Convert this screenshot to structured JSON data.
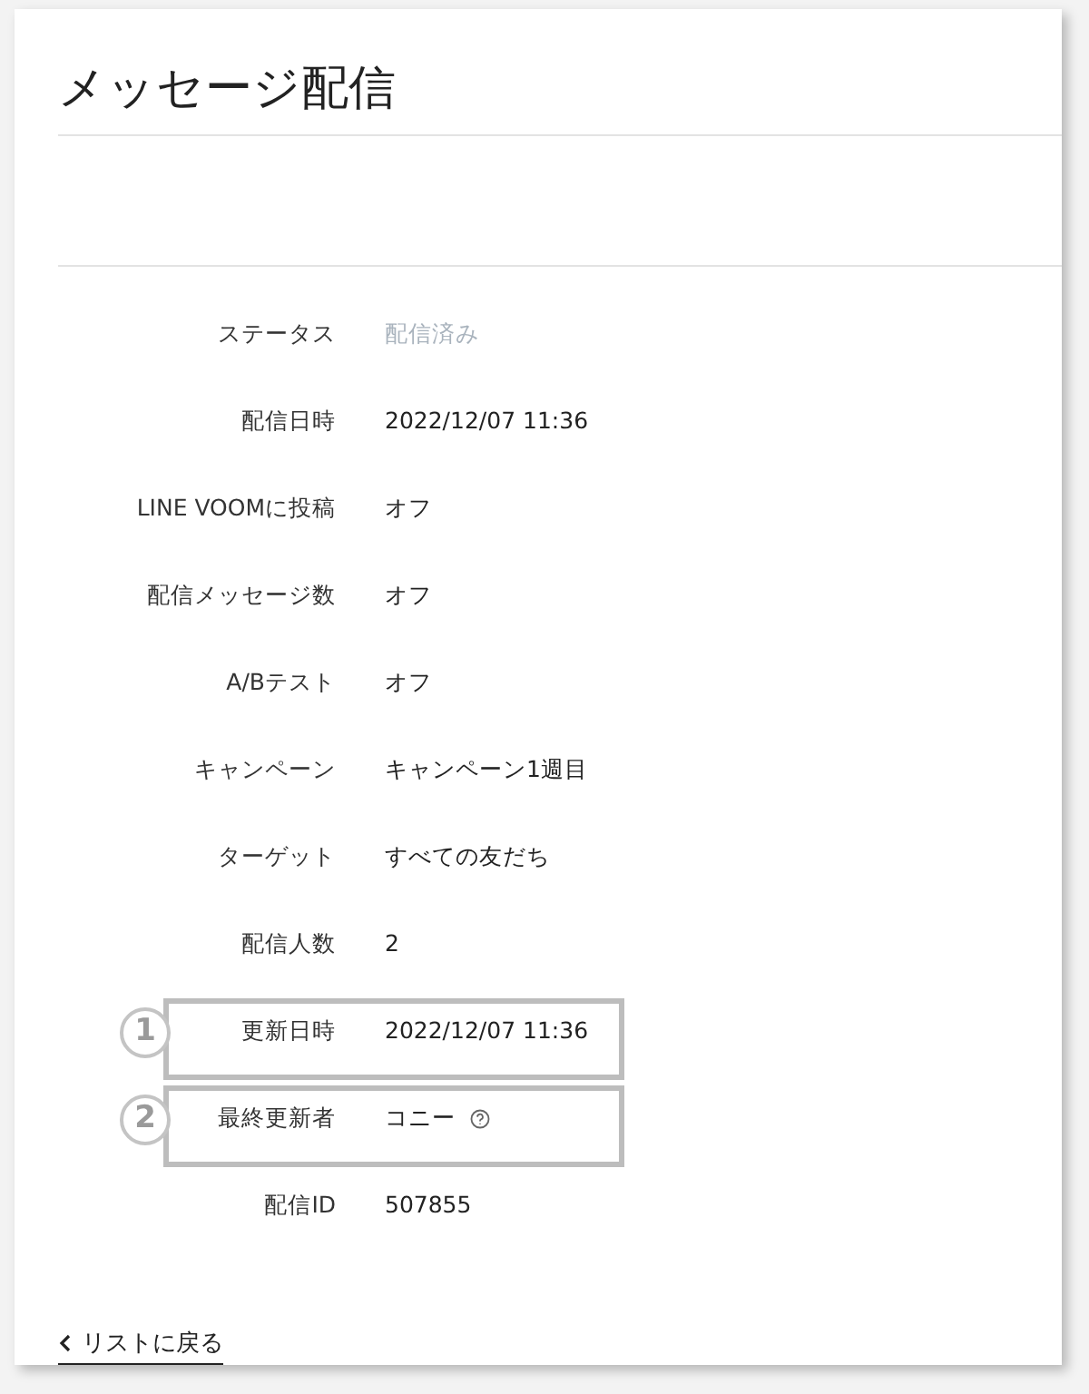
{
  "title": "メッセージ配信",
  "rows": [
    {
      "label": "ステータス",
      "value": "配信済み",
      "muted": true,
      "help": false
    },
    {
      "label": "配信日時",
      "value": "2022/12/07 11:36",
      "muted": false,
      "help": false
    },
    {
      "label": "LINE VOOMに投稿",
      "value": "オフ",
      "muted": false,
      "help": false
    },
    {
      "label": "配信メッセージ数",
      "value": "オフ",
      "muted": false,
      "help": false
    },
    {
      "label": "A/Bテスト",
      "value": "オフ",
      "muted": false,
      "help": false
    },
    {
      "label": "キャンペーン",
      "value": "キャンペーン1週目",
      "muted": false,
      "help": false
    },
    {
      "label": "ターゲット",
      "value": "すべての友だち",
      "muted": false,
      "help": false
    },
    {
      "label": "配信人数",
      "value": "2",
      "muted": false,
      "help": false
    },
    {
      "label": "更新日時",
      "value": "2022/12/07 11:36",
      "muted": false,
      "help": false,
      "callout": "1"
    },
    {
      "label": "最終更新者",
      "value": "コニー",
      "muted": false,
      "help": true,
      "callout": "2"
    },
    {
      "label": "配信ID",
      "value": "507855",
      "muted": false,
      "help": false
    }
  ],
  "back_link": "リストに戻る"
}
